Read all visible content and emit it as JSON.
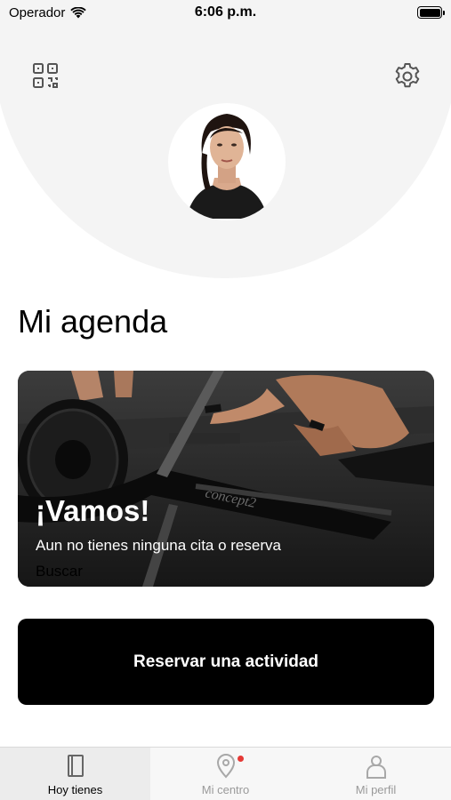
{
  "status_bar": {
    "carrier": "Operador",
    "time": "6:06 p.m."
  },
  "header": {
    "qr_icon": "qr-code-icon",
    "settings_icon": "gear-icon",
    "avatar_alt": "profile photo"
  },
  "agenda": {
    "title": "Mi agenda",
    "card": {
      "heading": "¡Vamos!",
      "subtitle": "Aun no tienes ninguna cita o reserva",
      "link": "Buscar",
      "machine_brand": "concept2"
    },
    "book_button": "Reservar una actividad"
  },
  "tab_bar": {
    "tabs": [
      {
        "label": "Hoy tienes",
        "icon": "book-icon",
        "active": true
      },
      {
        "label": "Mi centro",
        "icon": "location-pin-icon",
        "active": false,
        "badge": true
      },
      {
        "label": "Mi perfil",
        "icon": "person-icon",
        "active": false
      }
    ]
  },
  "colors": {
    "header_bg": "#f4f4f4",
    "button_bg": "#000000",
    "badge": "#e53935",
    "tab_inactive": "#9a9a9a"
  }
}
